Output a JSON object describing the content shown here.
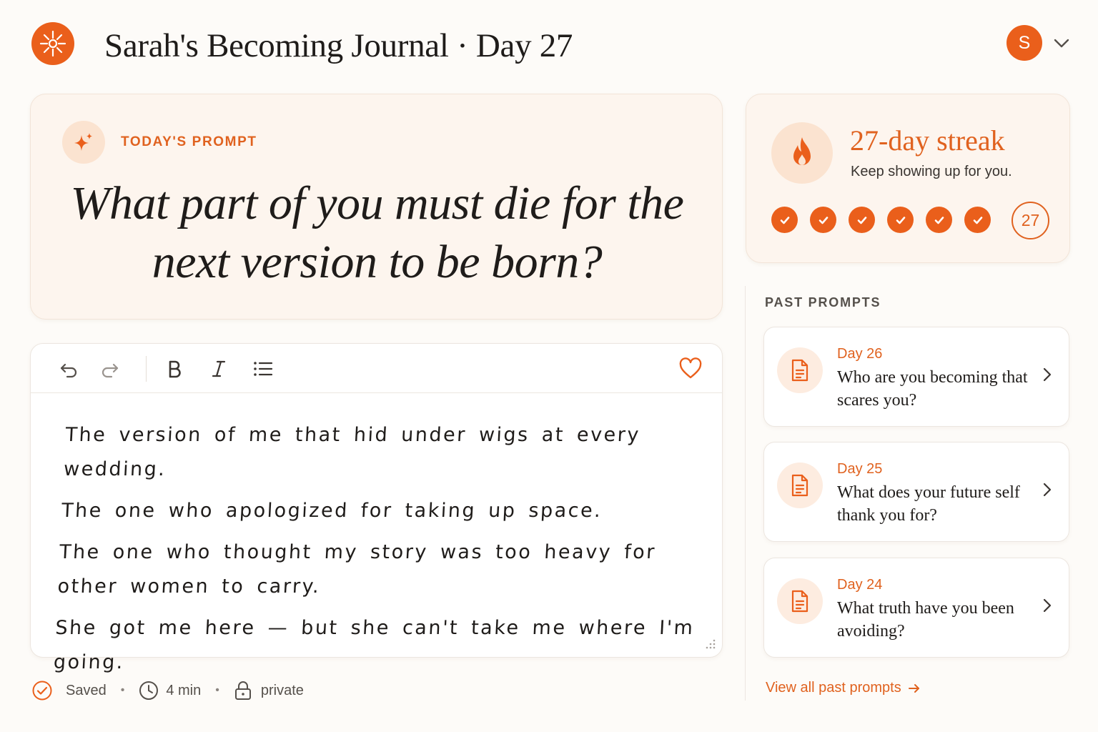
{
  "header": {
    "title": "Sarah's Becoming Journal · Day 27",
    "avatar_initial": "S",
    "logo_icon": "sunburst-icon"
  },
  "prompt": {
    "label": "TODAY'S PROMPT",
    "text": "What part of you must die for the next version to be born?"
  },
  "editor": {
    "toolbar": [
      "undo-icon",
      "redo-icon",
      "bold-icon",
      "italic-icon",
      "bullet-list-icon",
      "heart-icon"
    ],
    "lines": [
      "The version of me that hid under wigs at every wedding.",
      "The one who apologized for taking up space.",
      "The one who thought my story was too heavy for other women to carry.",
      "She got me here — but she can't take me where I'm going."
    ]
  },
  "status": {
    "saved": "Saved",
    "time": "4 min",
    "privacy": "private"
  },
  "streak": {
    "title": "27-day streak",
    "subtitle": "Keep showing up for you.",
    "completed_days": 6,
    "count": "27"
  },
  "past_prompts": {
    "label": "PAST PROMPTS",
    "items": [
      {
        "day": "Day 26",
        "question": "Who are you becoming that scares you?"
      },
      {
        "day": "Day 25",
        "question": "What does your future self thank you for?"
      },
      {
        "day": "Day 24",
        "question": "What truth have you been avoiding?"
      }
    ],
    "view_all": "View all past prompts"
  },
  "colors": {
    "accent": "#ea5f1b",
    "accent_text": "#e0621f",
    "card_bg": "#fdf5ee",
    "badge_bg": "#fbe3d0"
  }
}
